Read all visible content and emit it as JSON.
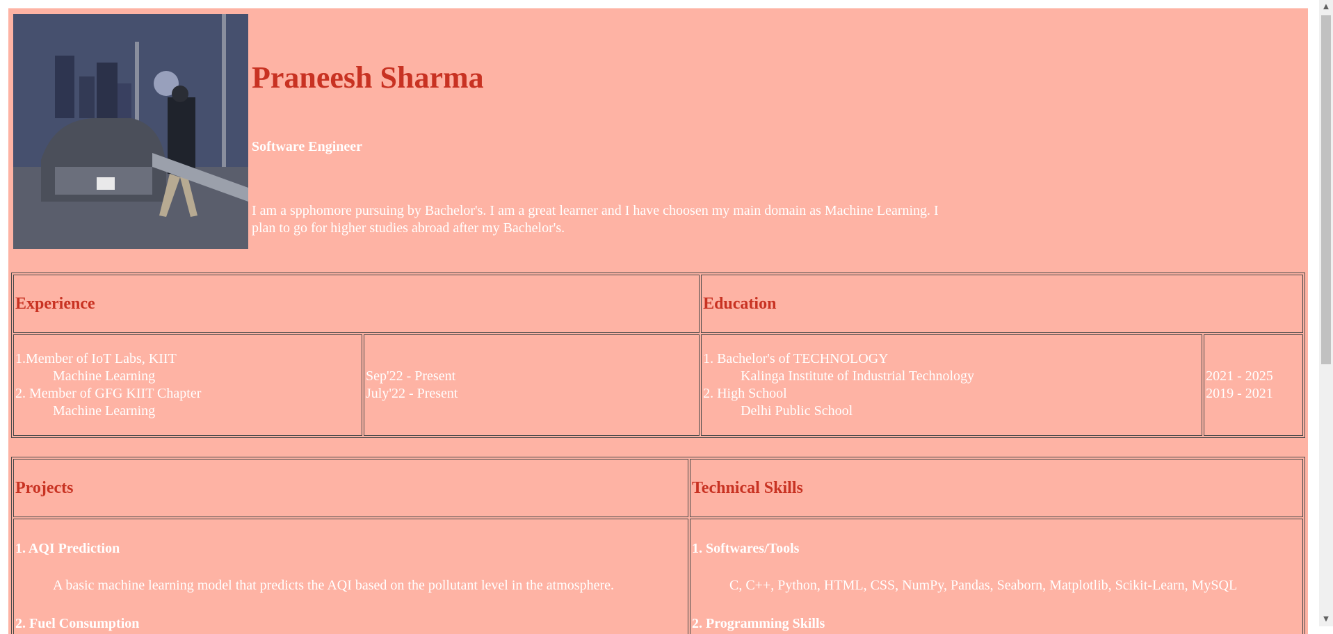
{
  "profile": {
    "name": "Praneesh Sharma",
    "title": "Software Engineer",
    "about": "I am a spphomore pursuing by Bachelor's. I am a great learner and I have choosen my main domain as Machine Learning. I plan to go for higher studies abroad after my Bachelor's."
  },
  "experience": {
    "heading": "Experience",
    "items": [
      {
        "title": "1.Member of IoT Labs, KIIT",
        "sub": "Machine Learning",
        "date": "Sep'22 - Present"
      },
      {
        "title": "2. Member of GFG KIIT Chapter",
        "sub": "Machine Learning",
        "date": "July'22 - Present"
      }
    ]
  },
  "education": {
    "heading": "Education",
    "items": [
      {
        "title": "1. Bachelor's of TECHNOLOGY",
        "sub": "Kalinga Institute of Industrial Technology",
        "date": "2021 - 2025"
      },
      {
        "title": "2. High School",
        "sub": "Delhi Public School",
        "date": "2019 - 2021"
      }
    ]
  },
  "projects": {
    "heading": "Projects",
    "items": [
      {
        "title": "1. AQI Prediction",
        "desc": "A basic machine learning model that predicts the AQI based on the pollutant level in the atmosphere."
      },
      {
        "title": "2. Fuel Consumption",
        "desc": ""
      }
    ]
  },
  "skills": {
    "heading": "Technical Skills",
    "items": [
      {
        "title": "1. Softwares/Tools",
        "desc": "C, C++, Python, HTML, CSS, NumPy, Pandas, Seaborn, Matplotlib, Scikit-Learn, MySQL"
      },
      {
        "title": "2. Programming Skills",
        "desc": ""
      }
    ]
  },
  "colors": {
    "background": "#feb3a4",
    "heading": "#c83222",
    "text": "#ffffff"
  }
}
